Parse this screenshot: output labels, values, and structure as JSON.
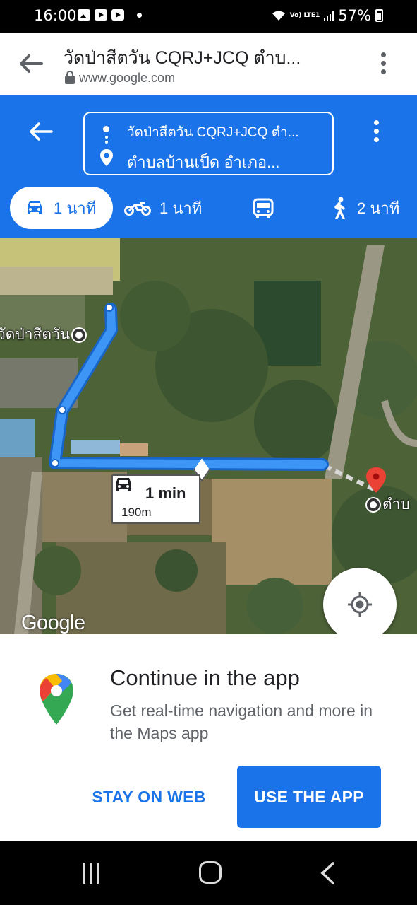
{
  "status_bar": {
    "time": "16:00",
    "network_label": "Vo) LTE1",
    "battery": "57%",
    "icons": [
      "gallery-icon",
      "youtube-icon",
      "youtube-icon",
      "notification-dot",
      "wifi-icon",
      "signal-icon",
      "battery-charging-icon"
    ]
  },
  "browser": {
    "title": "วัดป่าสีตวัน CQRJ+JCQ ตำบ...",
    "url": "www.google.com",
    "icons": [
      "back-arrow-icon",
      "lock-icon",
      "more-vert-icon"
    ]
  },
  "directions": {
    "from": "วัดป่าสีตวัน CQRJ+JCQ ตำ...",
    "to": "ตำบลบ้านเป็ด อำเภอ...",
    "modes": [
      {
        "name": "car",
        "label": "1 นาที",
        "active": true
      },
      {
        "name": "motorcycle",
        "label": "1 นาที",
        "active": false
      },
      {
        "name": "transit",
        "label": "",
        "active": false
      },
      {
        "name": "walk",
        "label": "2 นาที",
        "active": false
      }
    ],
    "accent_color": "#1a73e8"
  },
  "map": {
    "origin_label": "วัดป่าสีตวัน",
    "destination_label": "ตำบ",
    "route_callout": {
      "time": "1 min",
      "distance": "190m"
    },
    "attribution": "Google",
    "route_color": "#2f8cf2"
  },
  "sheet": {
    "title": "Continue in the app",
    "description": "Get real-time navigation and more in the Maps app",
    "stay_label": "STAY ON WEB",
    "app_label": "USE THE APP"
  }
}
